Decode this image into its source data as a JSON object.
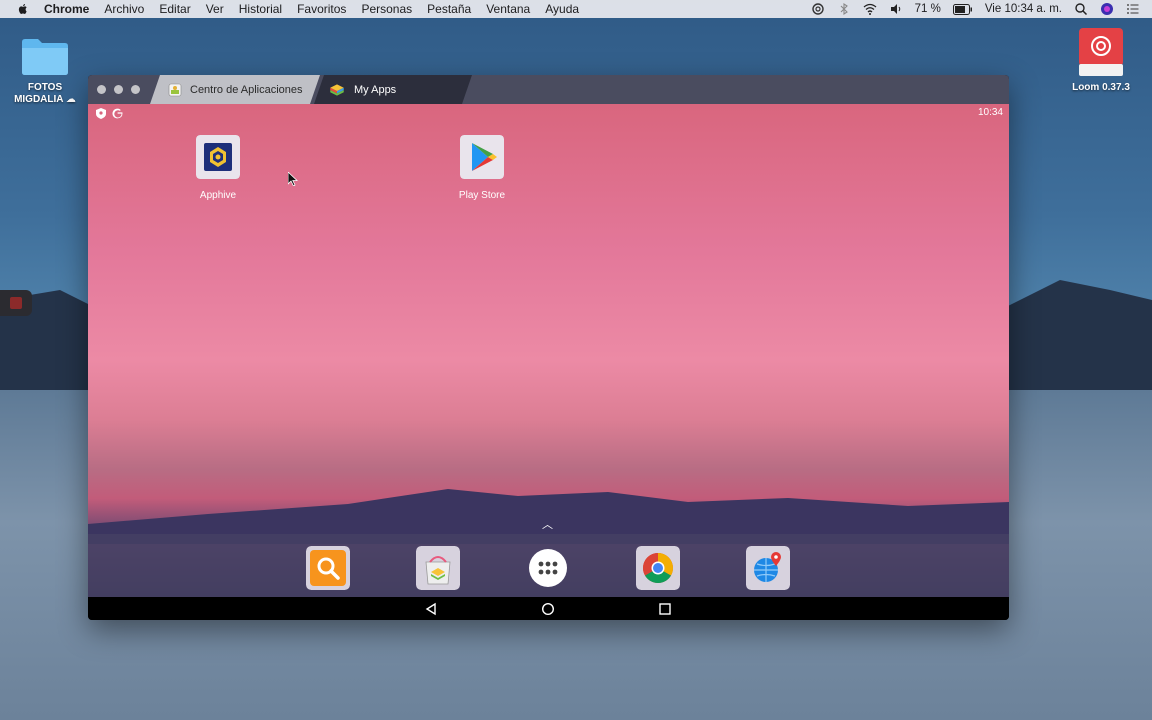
{
  "menubar": {
    "app_name": "Chrome",
    "items": [
      "Archivo",
      "Editar",
      "Ver",
      "Historial",
      "Favoritos",
      "Personas",
      "Pestaña",
      "Ventana",
      "Ayuda"
    ],
    "battery": "71 %",
    "clock": "Vie 10:34 a. m."
  },
  "desktop": {
    "folder_label_line1": "FOTOS",
    "folder_label_line2": "MIGDALIA",
    "loom_label": "Loom 0.37.3"
  },
  "window": {
    "tabs": [
      {
        "label": "Centro de Aplicaciones"
      },
      {
        "label": "My Apps"
      }
    ]
  },
  "android": {
    "time": "10:34",
    "apps": [
      {
        "label": "Apphive"
      },
      {
        "label": "Play Store"
      }
    ],
    "dock": [
      "search-icon",
      "app-center-icon",
      "all-apps-icon",
      "chrome-icon",
      "browser-icon"
    ]
  },
  "colors": {
    "accent_orange": "#f7941d",
    "menubar_bg": "#ececf0"
  }
}
